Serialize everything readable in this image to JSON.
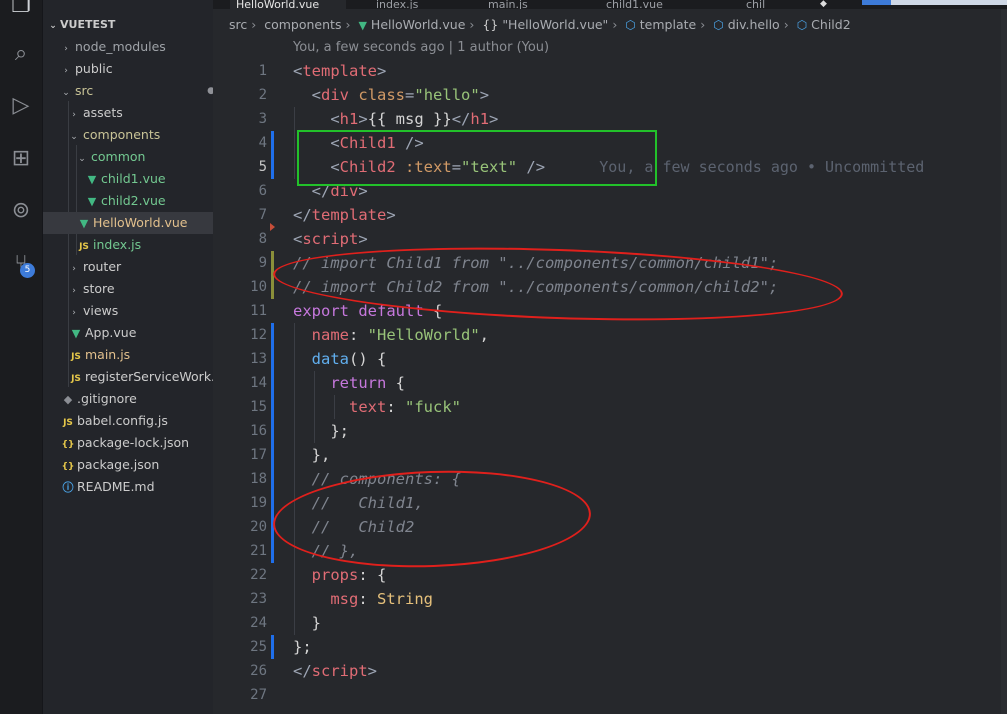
{
  "tabs": [
    {
      "label": "HelloWorld.vue",
      "active": true
    },
    {
      "label": "index.js",
      "active": false
    },
    {
      "label": "main.js",
      "active": false
    },
    {
      "label": "child1.vue",
      "active": false
    },
    {
      "label": "chil",
      "active": false
    }
  ],
  "top_progress_percent": 20,
  "activity_bar": {
    "icons": [
      "files-icon",
      "search-icon",
      "run-debug-icon",
      "extensions-icon",
      "remote-icon",
      "source-control-icon"
    ],
    "source_control_badge": "5"
  },
  "explorer": {
    "project_title": "VUETEST",
    "items": [
      {
        "label": "node_modules",
        "status": ""
      },
      {
        "label": "public",
        "status": ""
      },
      {
        "label": "src",
        "status": "●"
      },
      {
        "label": "assets",
        "status": ""
      },
      {
        "label": "components",
        "status": "●"
      },
      {
        "label": "common",
        "status": "●"
      },
      {
        "label": "child1.vue",
        "status": "U"
      },
      {
        "label": "child2.vue",
        "status": "U"
      },
      {
        "label": "HelloWorld.vue",
        "status": "M"
      },
      {
        "label": "index.js",
        "status": "U"
      },
      {
        "label": "router",
        "status": ""
      },
      {
        "label": "store",
        "status": ""
      },
      {
        "label": "views",
        "status": ""
      },
      {
        "label": "App.vue",
        "status": ""
      },
      {
        "label": "main.js",
        "status": "M"
      },
      {
        "label": "registerServiceWork...",
        "status": ""
      },
      {
        "label": ".gitignore",
        "status": ""
      },
      {
        "label": "babel.config.js",
        "status": ""
      },
      {
        "label": "package-lock.json",
        "status": ""
      },
      {
        "label": "package.json",
        "status": ""
      },
      {
        "label": "README.md",
        "status": ""
      }
    ]
  },
  "breadcrumb": [
    "src",
    "components",
    "HelloWorld.vue",
    "\"HelloWorld.vue\"",
    "template",
    "div.hello",
    "Child2"
  ],
  "codelens": "You, a few seconds ago | 1 author (You)",
  "inline_blame": "You, a few seconds ago • Uncommitted",
  "code_lines": [
    {
      "n": "1",
      "tokens": [
        [
          "tk-punc",
          "<"
        ],
        [
          "tk-tag",
          "template"
        ],
        [
          "tk-punc",
          ">"
        ]
      ]
    },
    {
      "n": "2",
      "tokens": [
        [
          "tk-txt",
          "  "
        ],
        [
          "tk-punc",
          "<"
        ],
        [
          "tk-tag",
          "div"
        ],
        [
          "tk-txt",
          " "
        ],
        [
          "tk-attr",
          "class"
        ],
        [
          "tk-punc",
          "="
        ],
        [
          "tk-str",
          "\"hello\""
        ],
        [
          "tk-punc",
          ">"
        ]
      ]
    },
    {
      "n": "3",
      "tokens": [
        [
          "tk-txt",
          "    "
        ],
        [
          "tk-punc",
          "<"
        ],
        [
          "tk-tag",
          "h1"
        ],
        [
          "tk-punc",
          ">"
        ],
        [
          "tk-txt",
          "{{ msg }}"
        ],
        [
          "tk-punc",
          "</"
        ],
        [
          "tk-tag",
          "h1"
        ],
        [
          "tk-punc",
          ">"
        ]
      ]
    },
    {
      "n": "4",
      "tokens": [
        [
          "tk-txt",
          "    "
        ],
        [
          "tk-punc",
          "<"
        ],
        [
          "tk-tag",
          "Child1"
        ],
        [
          "tk-txt",
          " "
        ],
        [
          "tk-punc",
          "/>"
        ]
      ]
    },
    {
      "n": "5",
      "tokens": [
        [
          "tk-txt",
          "    "
        ],
        [
          "tk-punc",
          "<"
        ],
        [
          "tk-tag",
          "Child2"
        ],
        [
          "tk-txt",
          " "
        ],
        [
          "tk-attr",
          ":text"
        ],
        [
          "tk-punc",
          "="
        ],
        [
          "tk-str",
          "\"text\""
        ],
        [
          "tk-txt",
          " "
        ],
        [
          "tk-punc",
          "/>"
        ]
      ]
    },
    {
      "n": "6",
      "tokens": [
        [
          "tk-txt",
          "  "
        ],
        [
          "tk-punc",
          "</"
        ],
        [
          "tk-tag",
          "div"
        ],
        [
          "tk-punc",
          ">"
        ]
      ]
    },
    {
      "n": "7",
      "tokens": [
        [
          "tk-punc",
          "</"
        ],
        [
          "tk-tag",
          "template"
        ],
        [
          "tk-punc",
          ">"
        ]
      ]
    },
    {
      "n": "8",
      "tokens": [
        [
          "tk-punc",
          "<"
        ],
        [
          "tk-tag",
          "script"
        ],
        [
          "tk-punc",
          ">"
        ]
      ]
    },
    {
      "n": "9",
      "tokens": [
        [
          "tk-cmt",
          "// import Child1 from \"../components/common/child1\";"
        ]
      ]
    },
    {
      "n": "10",
      "tokens": [
        [
          "tk-cmt",
          "// import Child2 from \"../components/common/child2\";"
        ]
      ]
    },
    {
      "n": "11",
      "tokens": [
        [
          "tk-kw",
          "export"
        ],
        [
          "tk-txt",
          " "
        ],
        [
          "tk-kw",
          "default"
        ],
        [
          "tk-txt",
          " {"
        ]
      ]
    },
    {
      "n": "12",
      "tokens": [
        [
          "tk-txt",
          "  "
        ],
        [
          "tk-prop",
          "name"
        ],
        [
          "tk-txt",
          ": "
        ],
        [
          "tk-str",
          "\"HelloWorld\""
        ],
        [
          "tk-txt",
          ","
        ]
      ]
    },
    {
      "n": "13",
      "tokens": [
        [
          "tk-txt",
          "  "
        ],
        [
          "tk-fn",
          "data"
        ],
        [
          "tk-txt",
          "() {"
        ]
      ]
    },
    {
      "n": "14",
      "tokens": [
        [
          "tk-txt",
          "    "
        ],
        [
          "tk-kw",
          "return"
        ],
        [
          "tk-txt",
          " {"
        ]
      ]
    },
    {
      "n": "15",
      "tokens": [
        [
          "tk-txt",
          "      "
        ],
        [
          "tk-prop",
          "text"
        ],
        [
          "tk-txt",
          ": "
        ],
        [
          "tk-str",
          "\"fuck\""
        ]
      ]
    },
    {
      "n": "16",
      "tokens": [
        [
          "tk-txt",
          "    };"
        ]
      ]
    },
    {
      "n": "17",
      "tokens": [
        [
          "tk-txt",
          "  },"
        ]
      ]
    },
    {
      "n": "18",
      "tokens": [
        [
          "tk-txt",
          "  "
        ],
        [
          "tk-cmt",
          "// components: {"
        ]
      ]
    },
    {
      "n": "19",
      "tokens": [
        [
          "tk-txt",
          "  "
        ],
        [
          "tk-cmt",
          "//   Child1,"
        ]
      ]
    },
    {
      "n": "20",
      "tokens": [
        [
          "tk-txt",
          "  "
        ],
        [
          "tk-cmt",
          "//   Child2"
        ]
      ]
    },
    {
      "n": "21",
      "tokens": [
        [
          "tk-txt",
          "  "
        ],
        [
          "tk-cmt",
          "// },"
        ]
      ]
    },
    {
      "n": "22",
      "tokens": [
        [
          "tk-txt",
          "  "
        ],
        [
          "tk-prop",
          "props"
        ],
        [
          "tk-txt",
          ": {"
        ]
      ]
    },
    {
      "n": "23",
      "tokens": [
        [
          "tk-txt",
          "    "
        ],
        [
          "tk-prop",
          "msg"
        ],
        [
          "tk-txt",
          ": "
        ],
        [
          "tk-type",
          "String"
        ]
      ]
    },
    {
      "n": "24",
      "tokens": [
        [
          "tk-txt",
          "  }"
        ]
      ]
    },
    {
      "n": "25",
      "tokens": [
        [
          "tk-txt",
          "};"
        ]
      ]
    },
    {
      "n": "26",
      "tokens": [
        [
          "tk-punc",
          "</"
        ],
        [
          "tk-tag",
          "script"
        ],
        [
          "tk-punc",
          ">"
        ]
      ]
    },
    {
      "n": "27",
      "tokens": []
    }
  ],
  "colors": {
    "annotation_box": "#22c12a",
    "annotation_ellipse": "#e0201c",
    "git_added": "#73c991",
    "git_modified": "#e2c08d",
    "accent": "#3d7bd9"
  }
}
